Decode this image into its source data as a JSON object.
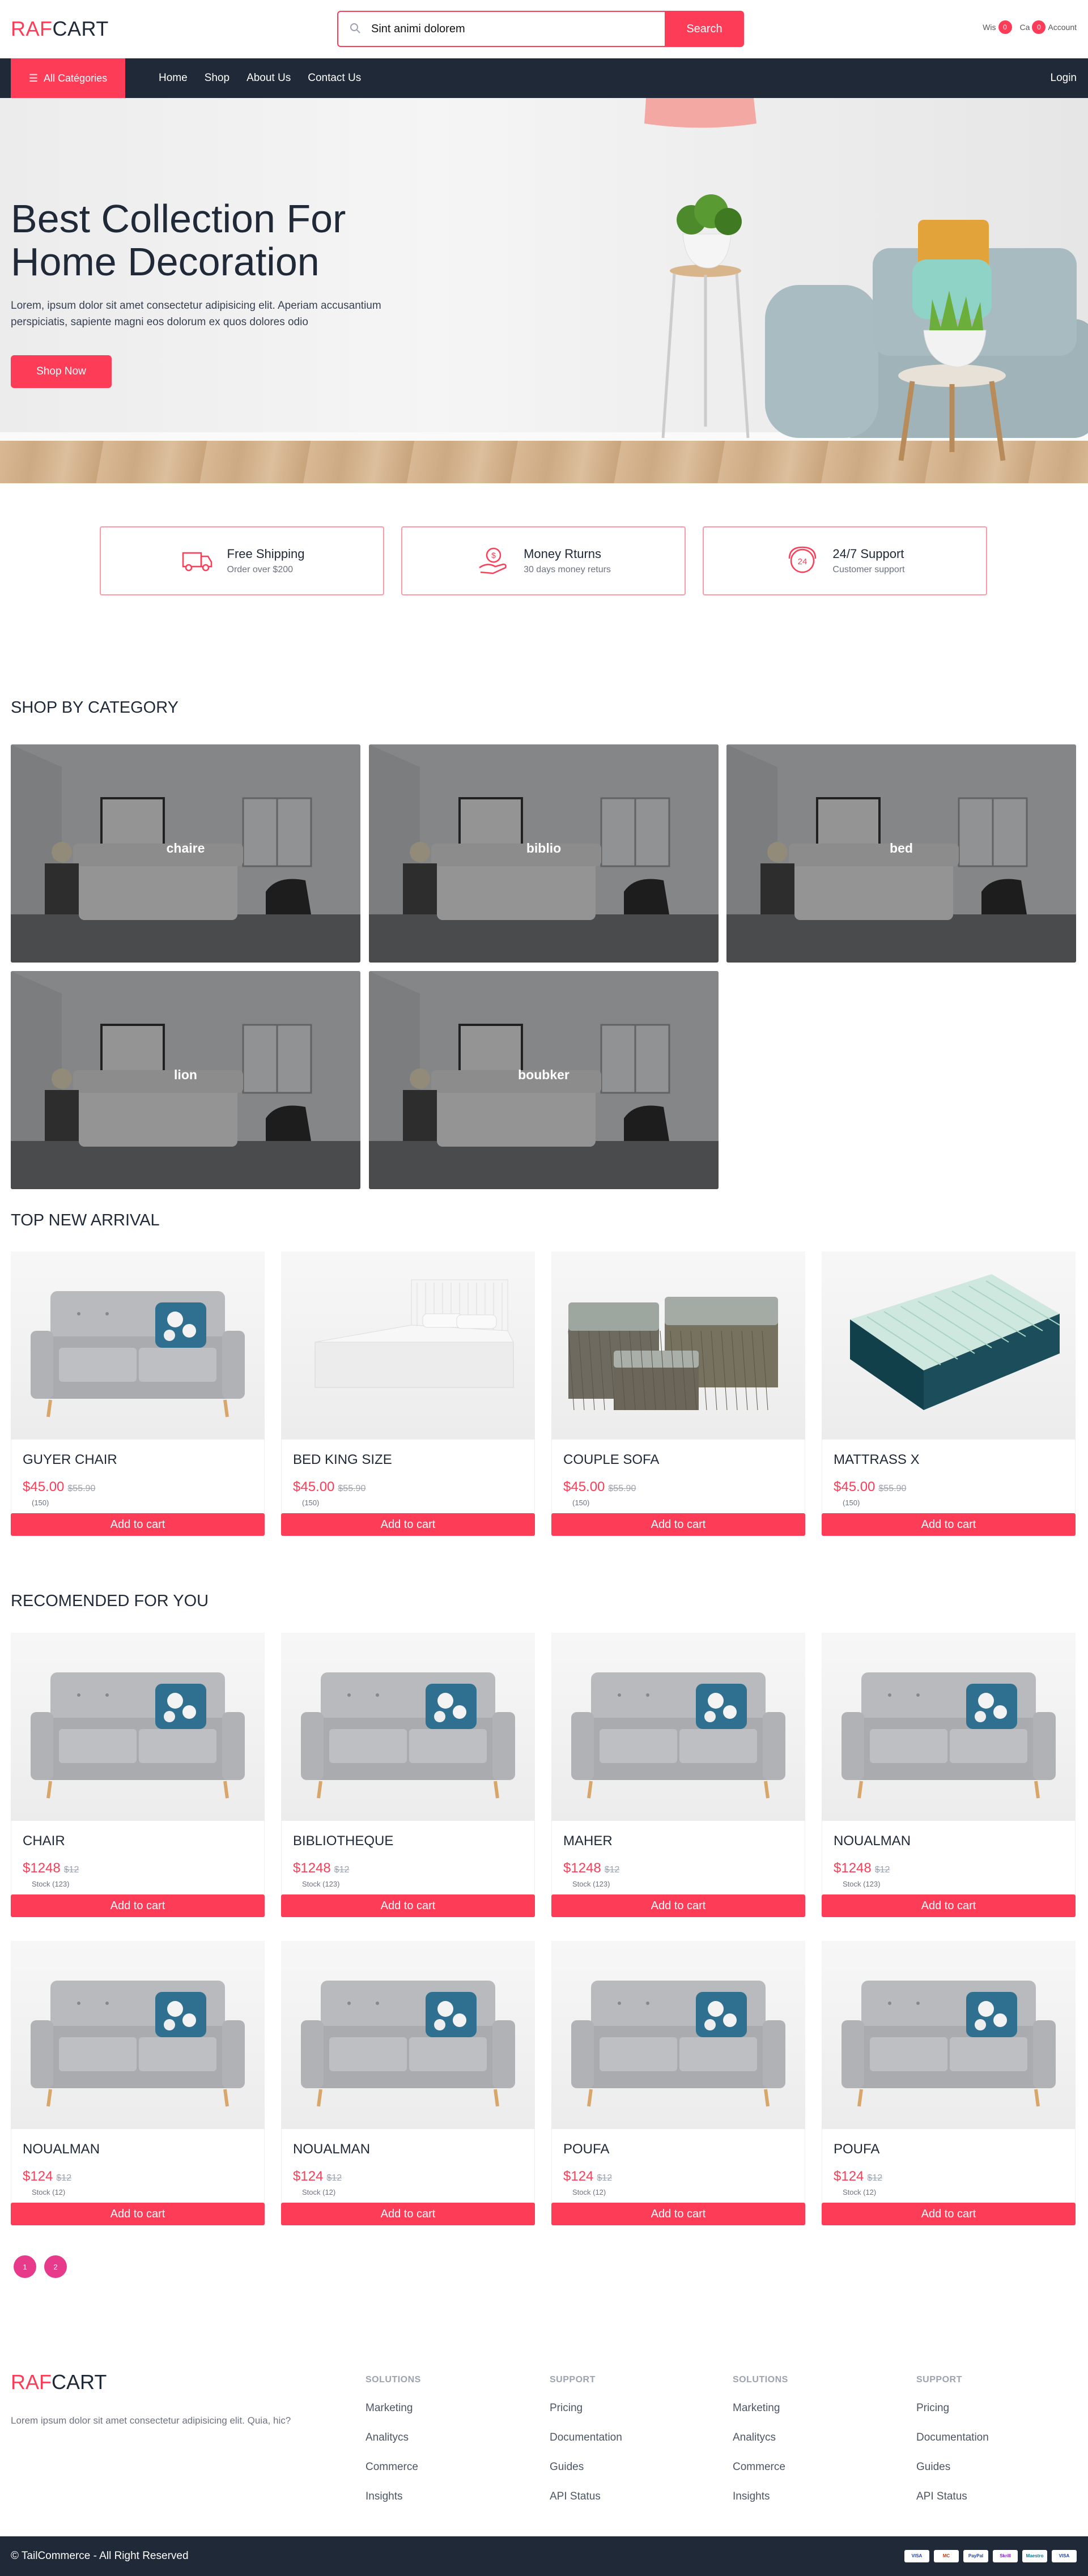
{
  "header": {
    "logo_part1": "RAF",
    "logo_part2": "CART",
    "search_value": "Sint animi dolorem",
    "search_button": "Search",
    "wishlist_label": "Wis",
    "wishlist_count": "0",
    "cart_label": "Ca",
    "cart_count": "0",
    "account_label": "Account"
  },
  "nav": {
    "all_categories": "All Catégories",
    "links": [
      "Home",
      "Shop",
      "About Us",
      "Contact Us"
    ],
    "login": "Login"
  },
  "hero": {
    "title": "Best Collection For Home Decoration",
    "text": "Lorem, ipsum dolor sit amet consectetur adipisicing elit. Aperiam accusantium perspiciatis, sapiente magni eos dolorum ex quos dolores odio",
    "button": "Shop Now"
  },
  "features": [
    {
      "title": "Free Shipping",
      "subtitle": "Order over $200",
      "icon": "truck-icon"
    },
    {
      "title": "Money Rturns",
      "subtitle": "30 days money returs",
      "icon": "money-return-icon"
    },
    {
      "title": "24/7 Support",
      "subtitle": "Customer support",
      "icon": "support-icon"
    }
  ],
  "categories": {
    "title": "SHOP BY CATEGORY",
    "items": [
      "chaire",
      "biblio",
      "bed",
      "lion",
      "boubker"
    ]
  },
  "new_arrival": {
    "title": "TOP NEW ARRIVAL",
    "items": [
      {
        "name": "GUYER CHAIR",
        "price": "$45.00",
        "old_price": "$55.90",
        "meta": "(150)",
        "image": "sofa"
      },
      {
        "name": "BED KING SIZE",
        "price": "$45.00",
        "old_price": "$55.90",
        "meta": "(150)",
        "image": "bed"
      },
      {
        "name": "COUPLE SOFA",
        "price": "$45.00",
        "old_price": "$55.90",
        "meta": "(150)",
        "image": "wicker"
      },
      {
        "name": "MATTRASS X",
        "price": "$45.00",
        "old_price": "$55.90",
        "meta": "(150)",
        "image": "mattress"
      }
    ],
    "add_label": "Add to cart"
  },
  "recommended": {
    "title": "RECOMENDED FOR YOU",
    "items": [
      {
        "name": "CHAIR",
        "price": "$1248",
        "old_price": "$12",
        "meta": "Stock (123)"
      },
      {
        "name": "BIBLIOTHEQUE",
        "price": "$1248",
        "old_price": "$12",
        "meta": "Stock (123)"
      },
      {
        "name": "MAHER",
        "price": "$1248",
        "old_price": "$12",
        "meta": "Stock (123)"
      },
      {
        "name": "NOUALMAN",
        "price": "$1248",
        "old_price": "$12",
        "meta": "Stock (123)"
      },
      {
        "name": "NOUALMAN",
        "price": "$124",
        "old_price": "$12",
        "meta": "Stock (12)"
      },
      {
        "name": "NOUALMAN",
        "price": "$124",
        "old_price": "$12",
        "meta": "Stock (12)"
      },
      {
        "name": "POUFA",
        "price": "$124",
        "old_price": "$12",
        "meta": "Stock (12)"
      },
      {
        "name": "POUFA",
        "price": "$124",
        "old_price": "$12",
        "meta": "Stock (12)"
      }
    ],
    "add_label": "Add to cart",
    "pages": [
      "1",
      "2"
    ]
  },
  "footer": {
    "logo_part1": "RAF",
    "logo_part2": "CART",
    "description": "Lorem ipsum dolor sit amet consectetur adipisicing elit. Quia, hic?",
    "columns": [
      {
        "title": "SOLUTIONS",
        "links": [
          "Marketing",
          "Analitycs",
          "Commerce",
          "Insights"
        ]
      },
      {
        "title": "SUPPORT",
        "links": [
          "Pricing",
          "Documentation",
          "Guides",
          "API Status"
        ]
      },
      {
        "title": "SOLUTIONS",
        "links": [
          "Marketing",
          "Analitycs",
          "Commerce",
          "Insights"
        ]
      },
      {
        "title": "SUPPORT",
        "links": [
          "Pricing",
          "Documentation",
          "Guides",
          "API Status"
        ]
      }
    ],
    "copyright": "© TailCommerce - All Right Reserved",
    "payments": [
      "VISA",
      "MC",
      "PayPal",
      "Skrill",
      "Maestro",
      "VISA"
    ]
  },
  "colors": {
    "accent": "#fd3d57",
    "dark": "#1f2937",
    "pager": "#e83a8a"
  }
}
